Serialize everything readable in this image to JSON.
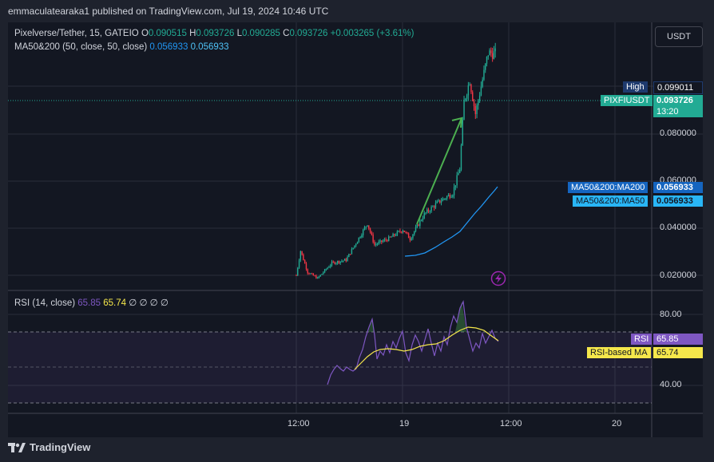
{
  "header": {
    "published": "emmaculatearaka1 published on TradingView.com, Jul 19, 2024 10:46 UTC"
  },
  "legend": {
    "symbol": "Pixelverse/Tether, 15, GATEIO",
    "o_label": "O",
    "o_value": "0.090515",
    "h_label": "H",
    "h_value": "0.093726",
    "l_label": "L",
    "l_value": "0.090285",
    "c_label": "C",
    "c_value": "0.093726",
    "change": "+0.003265 (+3.61%)",
    "ma_title": "MA50&200 (50, close, 50, close)",
    "ma_v1": "0.056933",
    "ma_v2": "0.056933",
    "rsi_title": "RSI (14, close)",
    "rsi_v1": "65.85",
    "rsi_v2": "65.74",
    "rsi_na": "∅ ∅ ∅ ∅"
  },
  "currency_button": "USDT",
  "price_axis": {
    "ticks": [
      "0.080000",
      "0.060000",
      "0.040000",
      "0.020000"
    ],
    "high_label": "High",
    "high_value": "0.099011",
    "symbol_label": "PIXFIUSDT",
    "symbol_value": "0.093726",
    "countdown": "13:20",
    "ma200_label": "MA50&200:MA200",
    "ma200_value": "0.056933",
    "ma50_label": "MA50&200:MA50",
    "ma50_value": "0.056933"
  },
  "rsi_axis": {
    "ticks": [
      "80.00",
      "40.00"
    ],
    "rsi_label": "RSI",
    "rsi_value": "65.85",
    "rsi_ma_label": "RSI-based MA",
    "rsi_ma_value": "65.74"
  },
  "time_axis": [
    "12:00",
    "19",
    "12:00",
    "20"
  ],
  "branding": "TradingView",
  "colors": {
    "up": "#22ab94",
    "down": "#f23645",
    "ma": "#2196f3",
    "rsi": "#7e57c2",
    "rsi_ma": "#f5e74b",
    "arrow": "#4caf50",
    "bg": "#131722"
  },
  "chart_data": {
    "type": "candlestick",
    "price_range": [
      0.016,
      0.104
    ],
    "price_series_approx": [
      {
        "t": 0,
        "close": 0.021
      },
      {
        "t": 3,
        "close": 0.029
      },
      {
        "t": 8,
        "close": 0.022
      },
      {
        "t": 15,
        "close": 0.02
      },
      {
        "t": 25,
        "close": 0.025
      },
      {
        "t": 35,
        "close": 0.026
      },
      {
        "t": 45,
        "close": 0.034
      },
      {
        "t": 50,
        "close": 0.038
      },
      {
        "t": 55,
        "close": 0.031
      },
      {
        "t": 65,
        "close": 0.033
      },
      {
        "t": 75,
        "close": 0.036
      },
      {
        "t": 80,
        "close": 0.033
      },
      {
        "t": 90,
        "close": 0.041
      },
      {
        "t": 100,
        "close": 0.045
      },
      {
        "t": 110,
        "close": 0.048
      },
      {
        "t": 115,
        "close": 0.056
      },
      {
        "t": 118,
        "close": 0.078
      },
      {
        "t": 122,
        "close": 0.085
      },
      {
        "t": 126,
        "close": 0.074
      },
      {
        "t": 130,
        "close": 0.083
      },
      {
        "t": 135,
        "close": 0.094
      },
      {
        "t": 140,
        "close": 0.0937
      }
    ],
    "ma_series_approx": [
      {
        "t": 75,
        "value": 0.028
      },
      {
        "t": 95,
        "value": 0.031
      },
      {
        "t": 110,
        "value": 0.037
      },
      {
        "t": 125,
        "value": 0.047
      },
      {
        "t": 140,
        "value": 0.0569
      }
    ],
    "rsi_range": [
      20,
      100
    ],
    "rsi_series_approx": [
      {
        "t": 25,
        "value": 40
      },
      {
        "t": 35,
        "value": 49
      },
      {
        "t": 45,
        "value": 55
      },
      {
        "t": 50,
        "value": 77
      },
      {
        "t": 55,
        "value": 56
      },
      {
        "t": 70,
        "value": 62
      },
      {
        "t": 85,
        "value": 75
      },
      {
        "t": 100,
        "value": 67
      },
      {
        "t": 112,
        "value": 70
      },
      {
        "t": 118,
        "value": 87
      },
      {
        "t": 125,
        "value": 65
      },
      {
        "t": 135,
        "value": 74
      },
      {
        "t": 140,
        "value": 65.85
      }
    ],
    "rsi_ma_series_approx": [
      {
        "t": 40,
        "value": 49
      },
      {
        "t": 55,
        "value": 59
      },
      {
        "t": 75,
        "value": 63
      },
      {
        "t": 95,
        "value": 64
      },
      {
        "t": 115,
        "value": 70
      },
      {
        "t": 128,
        "value": 72
      },
      {
        "t": 140,
        "value": 65.74
      }
    ],
    "rsi_bands": [
      70,
      50,
      30
    ]
  }
}
